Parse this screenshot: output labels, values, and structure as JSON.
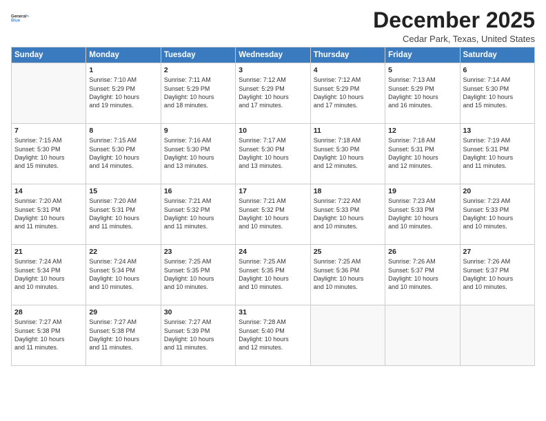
{
  "logo": {
    "line1": "General",
    "line2": "Blue"
  },
  "title": "December 2025",
  "location": "Cedar Park, Texas, United States",
  "days_of_week": [
    "Sunday",
    "Monday",
    "Tuesday",
    "Wednesday",
    "Thursday",
    "Friday",
    "Saturday"
  ],
  "weeks": [
    [
      {
        "num": "",
        "info": ""
      },
      {
        "num": "1",
        "info": "Sunrise: 7:10 AM\nSunset: 5:29 PM\nDaylight: 10 hours\nand 19 minutes."
      },
      {
        "num": "2",
        "info": "Sunrise: 7:11 AM\nSunset: 5:29 PM\nDaylight: 10 hours\nand 18 minutes."
      },
      {
        "num": "3",
        "info": "Sunrise: 7:12 AM\nSunset: 5:29 PM\nDaylight: 10 hours\nand 17 minutes."
      },
      {
        "num": "4",
        "info": "Sunrise: 7:12 AM\nSunset: 5:29 PM\nDaylight: 10 hours\nand 17 minutes."
      },
      {
        "num": "5",
        "info": "Sunrise: 7:13 AM\nSunset: 5:29 PM\nDaylight: 10 hours\nand 16 minutes."
      },
      {
        "num": "6",
        "info": "Sunrise: 7:14 AM\nSunset: 5:30 PM\nDaylight: 10 hours\nand 15 minutes."
      }
    ],
    [
      {
        "num": "7",
        "info": "Sunrise: 7:15 AM\nSunset: 5:30 PM\nDaylight: 10 hours\nand 15 minutes."
      },
      {
        "num": "8",
        "info": "Sunrise: 7:15 AM\nSunset: 5:30 PM\nDaylight: 10 hours\nand 14 minutes."
      },
      {
        "num": "9",
        "info": "Sunrise: 7:16 AM\nSunset: 5:30 PM\nDaylight: 10 hours\nand 13 minutes."
      },
      {
        "num": "10",
        "info": "Sunrise: 7:17 AM\nSunset: 5:30 PM\nDaylight: 10 hours\nand 13 minutes."
      },
      {
        "num": "11",
        "info": "Sunrise: 7:18 AM\nSunset: 5:30 PM\nDaylight: 10 hours\nand 12 minutes."
      },
      {
        "num": "12",
        "info": "Sunrise: 7:18 AM\nSunset: 5:31 PM\nDaylight: 10 hours\nand 12 minutes."
      },
      {
        "num": "13",
        "info": "Sunrise: 7:19 AM\nSunset: 5:31 PM\nDaylight: 10 hours\nand 11 minutes."
      }
    ],
    [
      {
        "num": "14",
        "info": "Sunrise: 7:20 AM\nSunset: 5:31 PM\nDaylight: 10 hours\nand 11 minutes."
      },
      {
        "num": "15",
        "info": "Sunrise: 7:20 AM\nSunset: 5:31 PM\nDaylight: 10 hours\nand 11 minutes."
      },
      {
        "num": "16",
        "info": "Sunrise: 7:21 AM\nSunset: 5:32 PM\nDaylight: 10 hours\nand 11 minutes."
      },
      {
        "num": "17",
        "info": "Sunrise: 7:21 AM\nSunset: 5:32 PM\nDaylight: 10 hours\nand 10 minutes."
      },
      {
        "num": "18",
        "info": "Sunrise: 7:22 AM\nSunset: 5:33 PM\nDaylight: 10 hours\nand 10 minutes."
      },
      {
        "num": "19",
        "info": "Sunrise: 7:23 AM\nSunset: 5:33 PM\nDaylight: 10 hours\nand 10 minutes."
      },
      {
        "num": "20",
        "info": "Sunrise: 7:23 AM\nSunset: 5:33 PM\nDaylight: 10 hours\nand 10 minutes."
      }
    ],
    [
      {
        "num": "21",
        "info": "Sunrise: 7:24 AM\nSunset: 5:34 PM\nDaylight: 10 hours\nand 10 minutes."
      },
      {
        "num": "22",
        "info": "Sunrise: 7:24 AM\nSunset: 5:34 PM\nDaylight: 10 hours\nand 10 minutes."
      },
      {
        "num": "23",
        "info": "Sunrise: 7:25 AM\nSunset: 5:35 PM\nDaylight: 10 hours\nand 10 minutes."
      },
      {
        "num": "24",
        "info": "Sunrise: 7:25 AM\nSunset: 5:35 PM\nDaylight: 10 hours\nand 10 minutes."
      },
      {
        "num": "25",
        "info": "Sunrise: 7:25 AM\nSunset: 5:36 PM\nDaylight: 10 hours\nand 10 minutes."
      },
      {
        "num": "26",
        "info": "Sunrise: 7:26 AM\nSunset: 5:37 PM\nDaylight: 10 hours\nand 10 minutes."
      },
      {
        "num": "27",
        "info": "Sunrise: 7:26 AM\nSunset: 5:37 PM\nDaylight: 10 hours\nand 10 minutes."
      }
    ],
    [
      {
        "num": "28",
        "info": "Sunrise: 7:27 AM\nSunset: 5:38 PM\nDaylight: 10 hours\nand 11 minutes."
      },
      {
        "num": "29",
        "info": "Sunrise: 7:27 AM\nSunset: 5:38 PM\nDaylight: 10 hours\nand 11 minutes."
      },
      {
        "num": "30",
        "info": "Sunrise: 7:27 AM\nSunset: 5:39 PM\nDaylight: 10 hours\nand 11 minutes."
      },
      {
        "num": "31",
        "info": "Sunrise: 7:28 AM\nSunset: 5:40 PM\nDaylight: 10 hours\nand 12 minutes."
      },
      {
        "num": "",
        "info": ""
      },
      {
        "num": "",
        "info": ""
      },
      {
        "num": "",
        "info": ""
      }
    ]
  ]
}
